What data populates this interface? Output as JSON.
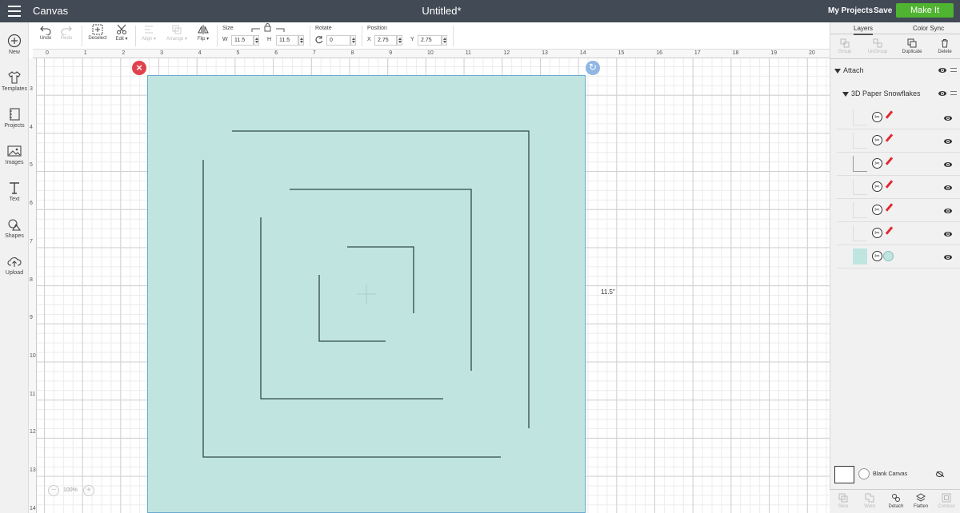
{
  "topbar": {
    "app_title": "Canvas",
    "doc_title": "Untitled*",
    "my_projects": "My Projects",
    "save": "Save",
    "make_it": "Make It"
  },
  "sidebar": {
    "items": [
      {
        "label": "New",
        "icon": "plus-circle-icon"
      },
      {
        "label": "Templates",
        "icon": "tshirt-icon"
      },
      {
        "label": "Projects",
        "icon": "notebook-icon"
      },
      {
        "label": "Images",
        "icon": "image-icon"
      },
      {
        "label": "Text",
        "icon": "text-icon"
      },
      {
        "label": "Shapes",
        "icon": "shapes-icon"
      },
      {
        "label": "Upload",
        "icon": "cloud-upload-icon"
      }
    ]
  },
  "toolbar": {
    "undo": "Undo",
    "redo": "Redo",
    "deselect": "Deselect",
    "edit": "Edit",
    "align": "Align",
    "arrange": "Arrange",
    "flip": "Flip",
    "size_label": "Size",
    "w_label": "W",
    "w_value": "11.5",
    "h_label": "H",
    "h_value": "11.5",
    "rotate_label": "Rotate",
    "rotate_value": "0",
    "position_label": "Position",
    "x_label": "X",
    "x_value": "2.75",
    "y_label": "Y",
    "y_value": "2.75"
  },
  "ruler": {
    "top": [
      "0",
      "1",
      "2",
      "3",
      "4",
      "5",
      "6",
      "7",
      "8",
      "9",
      "10",
      "11",
      "12",
      "13",
      "14",
      "15",
      "16",
      "17",
      "18",
      "19",
      "20"
    ],
    "left": [
      "3",
      "4",
      "5",
      "6",
      "7",
      "8",
      "9",
      "10",
      "11",
      "12",
      "13",
      "14"
    ]
  },
  "canvas": {
    "dimension_label": "11.5\"",
    "zoom": "100%"
  },
  "panel": {
    "tabs": [
      "Layers",
      "Color Sync"
    ],
    "actions": {
      "group": "Group",
      "ungroup": "UnGroup",
      "duplicate": "Duplicate",
      "delete": "Delete"
    },
    "attach_label": "Attach",
    "group_label": "3D Paper Snowflakes",
    "blank_canvas": "Blank Canvas",
    "bottom_actions": {
      "slice": "Slice",
      "weld": "Weld",
      "detach": "Detach",
      "flatten": "Flatten",
      "contour": "Contour"
    }
  },
  "colors": {
    "topbar": "#414a55",
    "make_it": "#4fb431",
    "mat": "#c0e5e1",
    "close_handle": "#e0424d",
    "rotate_handle": "#8fb7e3",
    "pen": "#e0292f"
  }
}
